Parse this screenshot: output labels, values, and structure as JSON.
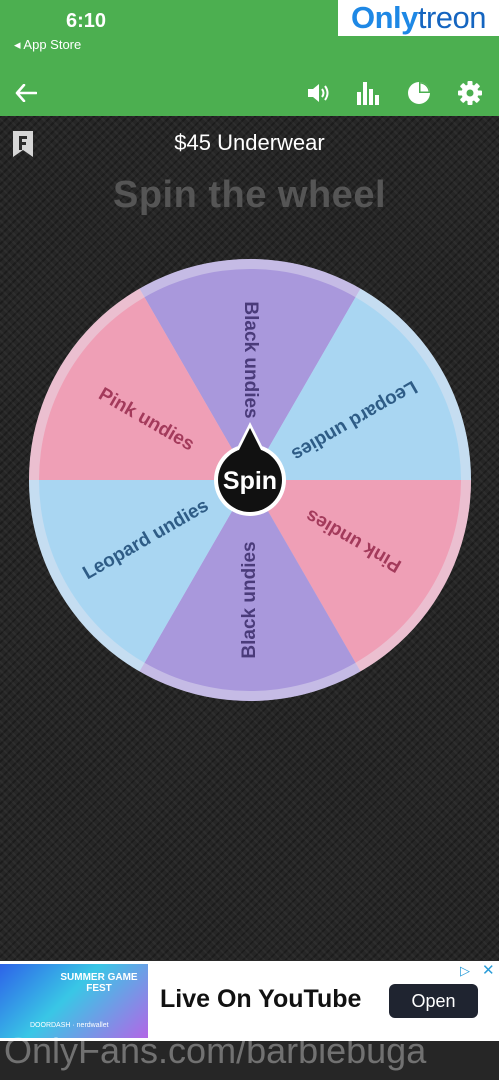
{
  "status": {
    "time": "6:10",
    "back_app": "◂ App Store"
  },
  "watermark": {
    "brand_a": "Only",
    "brand_b": "treon",
    "footer": "OnlyFans.com/barbiebuga"
  },
  "toolbar": {
    "icons": [
      "back-arrow-icon",
      "sound-icon",
      "stats-icon",
      "pie-chart-icon",
      "settings-icon"
    ]
  },
  "wheel": {
    "title": "$45 Underwear",
    "headline": "Spin the wheel",
    "spin_label": "Spin",
    "segments": [
      {
        "label": "Black undies",
        "color": "#a998dc"
      },
      {
        "label": "Leopard undies",
        "color": "#a9d6f2"
      },
      {
        "label": "Pink undies",
        "color": "#ef9fb6"
      },
      {
        "label": "Black undies",
        "color": "#a998dc"
      },
      {
        "label": "Leopard undies",
        "color": "#a9d6f2"
      },
      {
        "label": "Pink undies",
        "color": "#ef9fb6"
      }
    ],
    "colors": {
      "label_purple": "#4a3b7a",
      "label_blue": "#2e5c86",
      "label_pink": "#a33a5b"
    }
  },
  "ad": {
    "image_text": "SUMMER GAME FEST",
    "image_footer": "DOORDASH · nerdwallet",
    "headline": "Live On YouTube",
    "button": "Open"
  },
  "colors": {
    "green": "#4caf50",
    "background": "#262626"
  }
}
